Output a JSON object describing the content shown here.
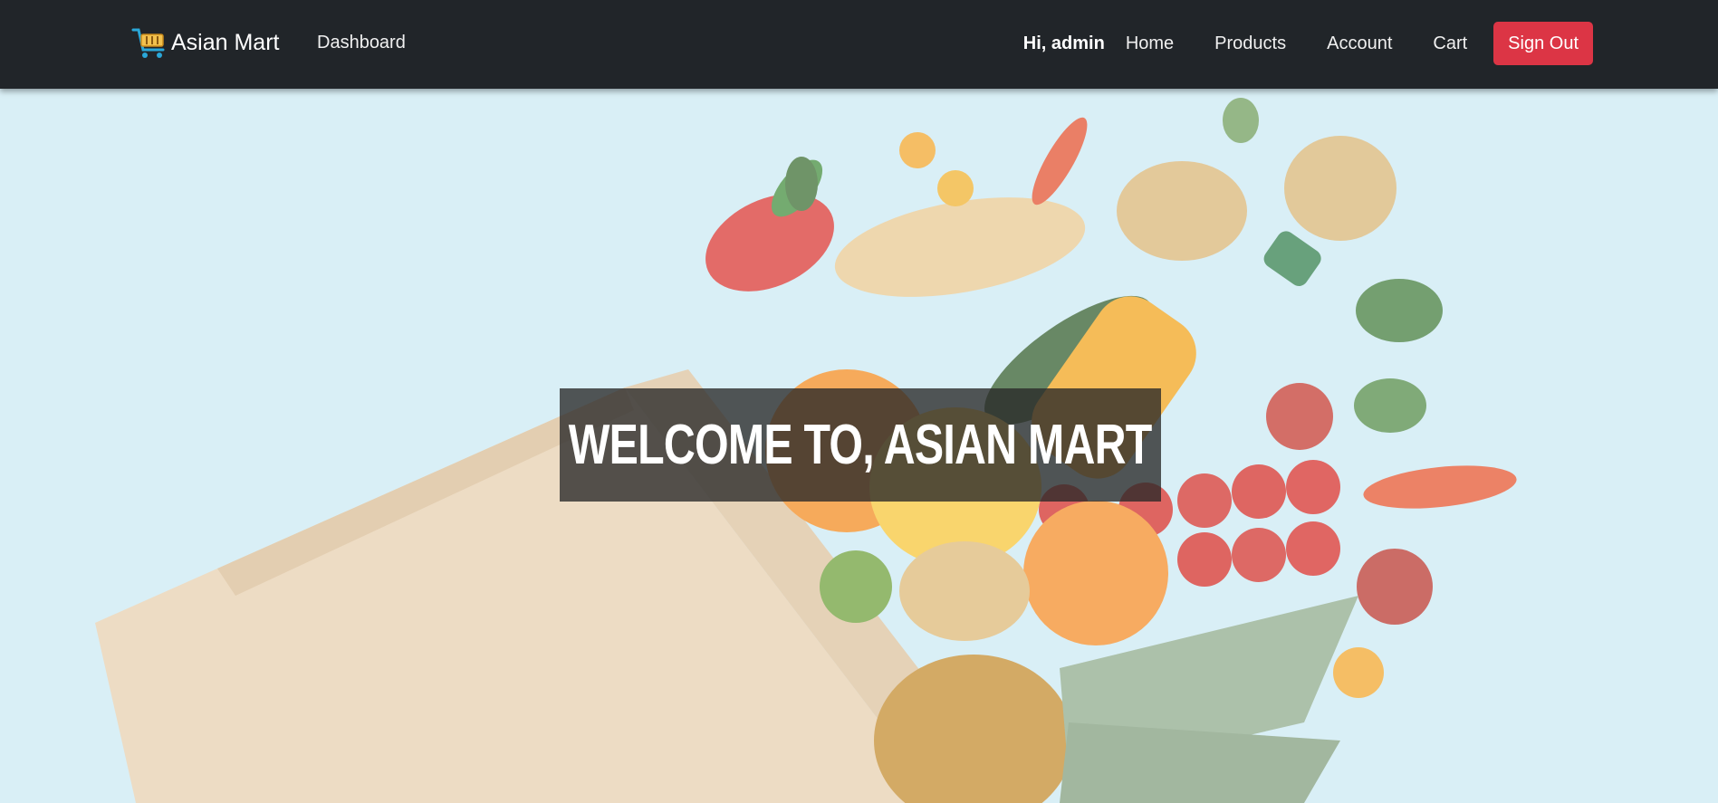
{
  "navbar": {
    "brand": "Asian Mart",
    "brand_icon": "shopping-cart-icon",
    "dashboard": "Dashboard",
    "greeting": "Hi, admin",
    "links": [
      "Home",
      "Products",
      "Account",
      "Cart"
    ],
    "sign_out": "Sign Out"
  },
  "hero": {
    "title": "WELCOME TO, ASIAN MART",
    "image": "grocery-bag-produce-image"
  },
  "colors": {
    "navbar_bg": "#212529",
    "sign_out_bg": "#dc3545",
    "hero_bg": "#cbe9f3"
  }
}
